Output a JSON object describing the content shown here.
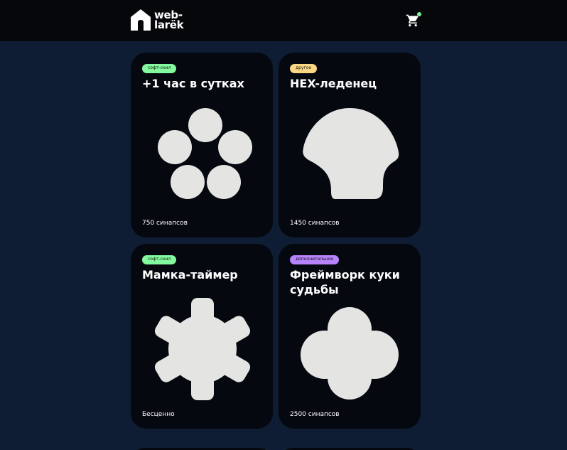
{
  "header": {
    "logo_text": "web-\nlarёk",
    "logo_icon": "house-icon",
    "cart_icon": "cart-icon",
    "cart_indicator_color": "#7ef098"
  },
  "cards": [
    {
      "category": "софт-скил",
      "category_color": "#83fa9d",
      "title": "+1 час в сутках",
      "price": "750 синапсов",
      "image_icon": "five-circles-icon"
    },
    {
      "category": "другое",
      "category_color": "#fad883",
      "title": "HEX-леденец",
      "price": "1450 синапсов",
      "image_icon": "shell-icon"
    },
    {
      "category": "софт-скил",
      "category_color": "#83fa9d",
      "title": "Мамка-таймер",
      "price": "Бесценно",
      "image_icon": "gear-icon"
    },
    {
      "category": "дополнительное",
      "category_color": "#b783fa",
      "title": "Фреймворк куки судьбы",
      "price": "2500 синапсов",
      "image_icon": "clover-icon"
    }
  ]
}
